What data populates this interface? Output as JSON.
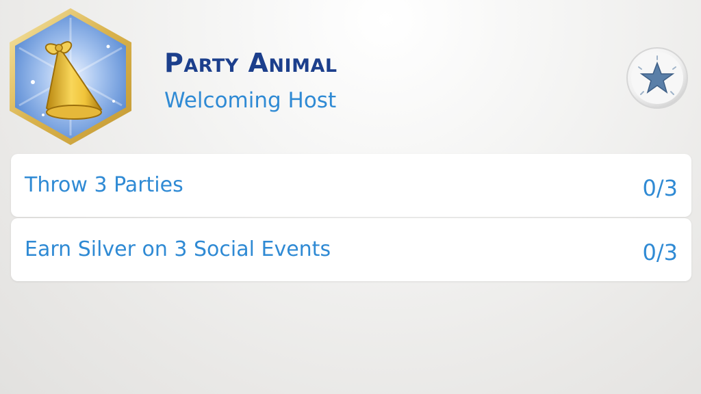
{
  "aspiration": {
    "title": "Party Animal",
    "subtitle": "Welcoming Host",
    "badge_icon": "party-hat-icon",
    "reward_icon": "star-icon"
  },
  "goals": [
    {
      "label": "Throw 3 Parties",
      "progress": "0/3"
    },
    {
      "label": "Earn Silver on 3 Social Events",
      "progress": "0/3"
    }
  ],
  "colors": {
    "title": "#1c3f8c",
    "accent": "#2f8ad4",
    "badge_frame": "#e2c060",
    "badge_fill": "#7fa8e0"
  }
}
